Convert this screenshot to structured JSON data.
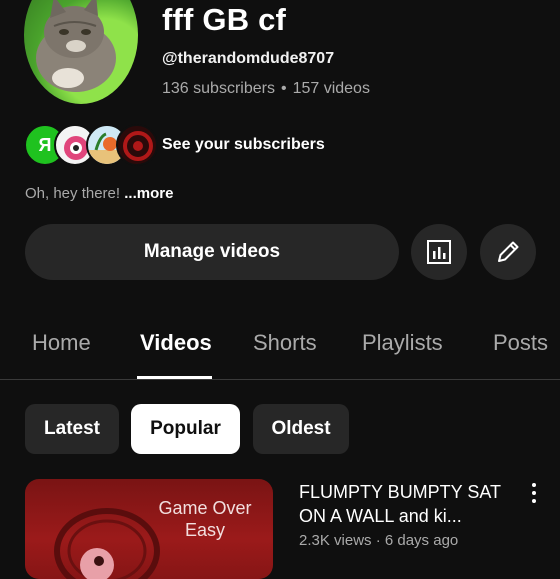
{
  "channel": {
    "name": "fff GB cf",
    "handle": "@therandomdude8707",
    "subscribers": "136 subscribers",
    "separator": "•",
    "videos": "157 videos",
    "see_subscribers": "See your subscribers",
    "description": "Oh, hey there!",
    "more": "...more",
    "subscriber_avatar_letter": "Я"
  },
  "actions": {
    "manage_videos": "Manage videos"
  },
  "tabs": [
    {
      "label": "Home"
    },
    {
      "label": "Videos"
    },
    {
      "label": "Shorts"
    },
    {
      "label": "Playlists"
    },
    {
      "label": "Posts"
    }
  ],
  "active_tab": "Videos",
  "chips": [
    {
      "label": "Latest"
    },
    {
      "label": "Popular"
    },
    {
      "label": "Oldest"
    }
  ],
  "selected_chip": "Popular",
  "video": {
    "thumbnail_text": "Game Over Easy",
    "title": "FLUMPTY BUMPTY SAT ON A WALL and ki...",
    "meta": "2.3K views · 6 days ago"
  },
  "colors": {
    "background": "#0f0f0f",
    "button_bg": "#272727",
    "secondary_text": "#aaaaaa"
  }
}
